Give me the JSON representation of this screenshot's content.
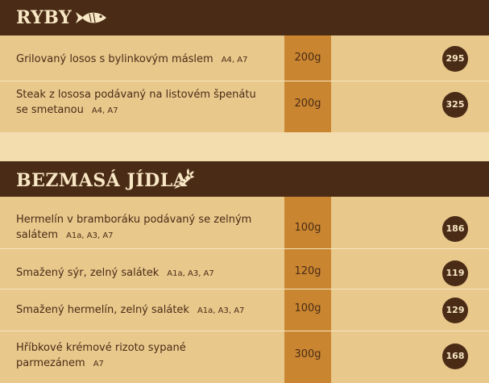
{
  "sections": [
    {
      "title": "RYBY",
      "icon": "fish-icon",
      "items": [
        {
          "name": "Grilovaný losos s bylinkovým máslem",
          "name2": "",
          "allergens": "A4, A7",
          "weight": "200g",
          "price": "295"
        },
        {
          "name": "Steak z lososa podávaný na listovém špenátu",
          "name2": "se smetanou",
          "allergens": "A4, A7",
          "weight": "200g",
          "price": "325"
        }
      ]
    },
    {
      "title": "BEZMASÁ JÍDLA",
      "icon": "carrot-icon",
      "items": [
        {
          "name": "Hermelín v bramboráku podávaný se zelným",
          "name2": "salátem",
          "allergens": "A1a, A3, A7",
          "weight": "100g",
          "price": "186"
        },
        {
          "name": "Smažený sýr, zelný salátek",
          "name2": "",
          "allergens": "A1a, A3, A7",
          "weight": "120g",
          "price": "119"
        },
        {
          "name": "Smažený hermelín, zelný salátek",
          "name2": "",
          "allergens": "A1a, A3, A7",
          "weight": "100g",
          "price": "129"
        },
        {
          "name": "Hříbkové krémové rizoto sypané",
          "name2": "parmezánem",
          "allergens": "A7",
          "weight": "300g",
          "price": "168"
        }
      ]
    }
  ],
  "colors": {
    "header": "#4a2c16",
    "band": "#e9c88c",
    "weight_column": "#c98530",
    "background": "#f3dcae"
  }
}
